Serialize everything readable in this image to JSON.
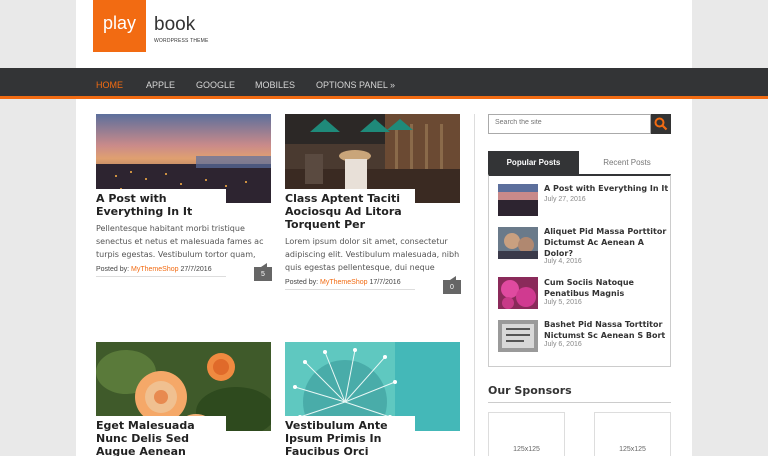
{
  "header": {
    "logo_left": "play",
    "logo_right": "book",
    "logo_tagline": "WORDPRESS THEME"
  },
  "nav": {
    "items": [
      "HOME",
      "APPLE",
      "GOOGLE",
      "MOBILES",
      "OPTIONS PANEL »"
    ]
  },
  "posts": [
    {
      "title": "A Post with Everything In It",
      "excerpt": "Pellentesque habitant morbi tristique senectus et netus et malesuada fames ac turpis egestas. Vestibulum tortor quam,",
      "meta_prefix": "Posted by: ",
      "author": "MyThemeShop",
      "date": "27/7/2016",
      "comments": "5"
    },
    {
      "title": "Class Aptent Taciti Aociosqu Ad Litora Torquent Per",
      "excerpt": "Lorem ipsum dolor sit amet, consectetur adipiscing elit. Vestibulum malesuada, nibh quis egestas pellentesque, dui neque",
      "meta_prefix": "Posted by: ",
      "author": "MyThemeShop",
      "date": "17/7/2016",
      "comments": "0"
    },
    {
      "title": "Eget Malesuada Nunc Delis Sed Augue Aenean"
    },
    {
      "title": "Vestibulum Ante Ipsum Primis In Faucibus Orci Luctus"
    }
  ],
  "sidebar": {
    "search_placeholder": "Search the site",
    "tabs": {
      "popular": "Popular Posts",
      "recent": "Recent Posts"
    },
    "popular_posts": [
      {
        "title": "A Post with Everything In It",
        "date": "July 27, 2016"
      },
      {
        "title": "Aliquet Pid Massa Porttitor Dictumst Ac Aenean A Dolor?",
        "date": "July 4, 2016"
      },
      {
        "title": "Cum Sociis Natoque Penatibus Magnis",
        "date": "July 5, 2016"
      },
      {
        "title": "Bashet Pid Nassa Torttitor Nictumst Sc Aenean S Bort",
        "date": "July 6, 2016"
      }
    ],
    "sponsors_title": "Our Sponsors",
    "ads": [
      "125x125",
      "125x125"
    ]
  },
  "colors": {
    "accent": "#f26b12",
    "nav_bg": "#333436"
  }
}
